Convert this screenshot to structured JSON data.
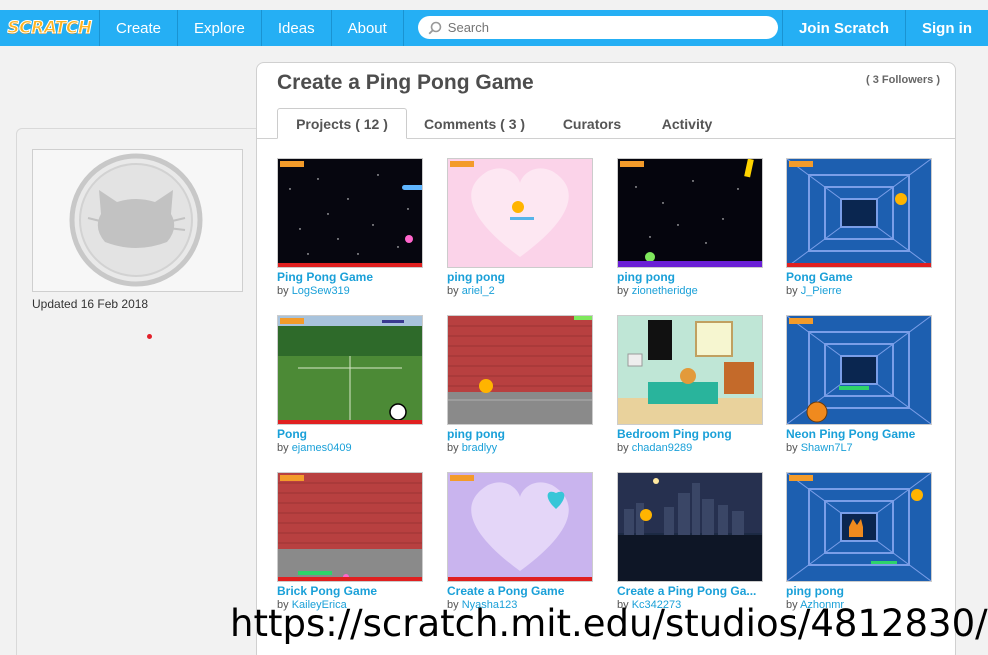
{
  "nav": {
    "logo": "SCRATCH",
    "links": [
      "Create",
      "Explore",
      "Ideas",
      "About"
    ],
    "search_placeholder": "Search",
    "join": "Join Scratch",
    "signin": "Sign in"
  },
  "sidebar": {
    "updated": "Updated 16 Feb 2018"
  },
  "studio": {
    "title": "Create a Ping Pong Game",
    "followers": "( 3 Followers )",
    "tabs": [
      "Projects ( 12 )",
      "Comments ( 3 )",
      "Curators",
      "Activity"
    ]
  },
  "projects": [
    {
      "title": "Ping Pong Game",
      "author": "LogSew319"
    },
    {
      "title": "ping pong",
      "author": "ariel_2"
    },
    {
      "title": "ping pong",
      "author": "zionetheridge"
    },
    {
      "title": "Pong Game",
      "author": "J_Pierre"
    },
    {
      "title": "Pong",
      "author": "ejames0409"
    },
    {
      "title": "ping pong",
      "author": "bradlyy"
    },
    {
      "title": "Bedroom Ping pong",
      "author": "chadan9289"
    },
    {
      "title": "Neon Ping Pong Game",
      "author": "Shawn7L7"
    },
    {
      "title": "Brick Pong Game",
      "author": "KaileyErica"
    },
    {
      "title": "Create a Pong Game",
      "author": "Nyasha123"
    },
    {
      "title": "Create a Ping Pong Ga...",
      "author": "Kc342273"
    },
    {
      "title": "ping pong",
      "author": "Azhonmr"
    }
  ],
  "by_label": "by",
  "overlay_url": "https://scratch.mit.edu/studios/4812830/"
}
